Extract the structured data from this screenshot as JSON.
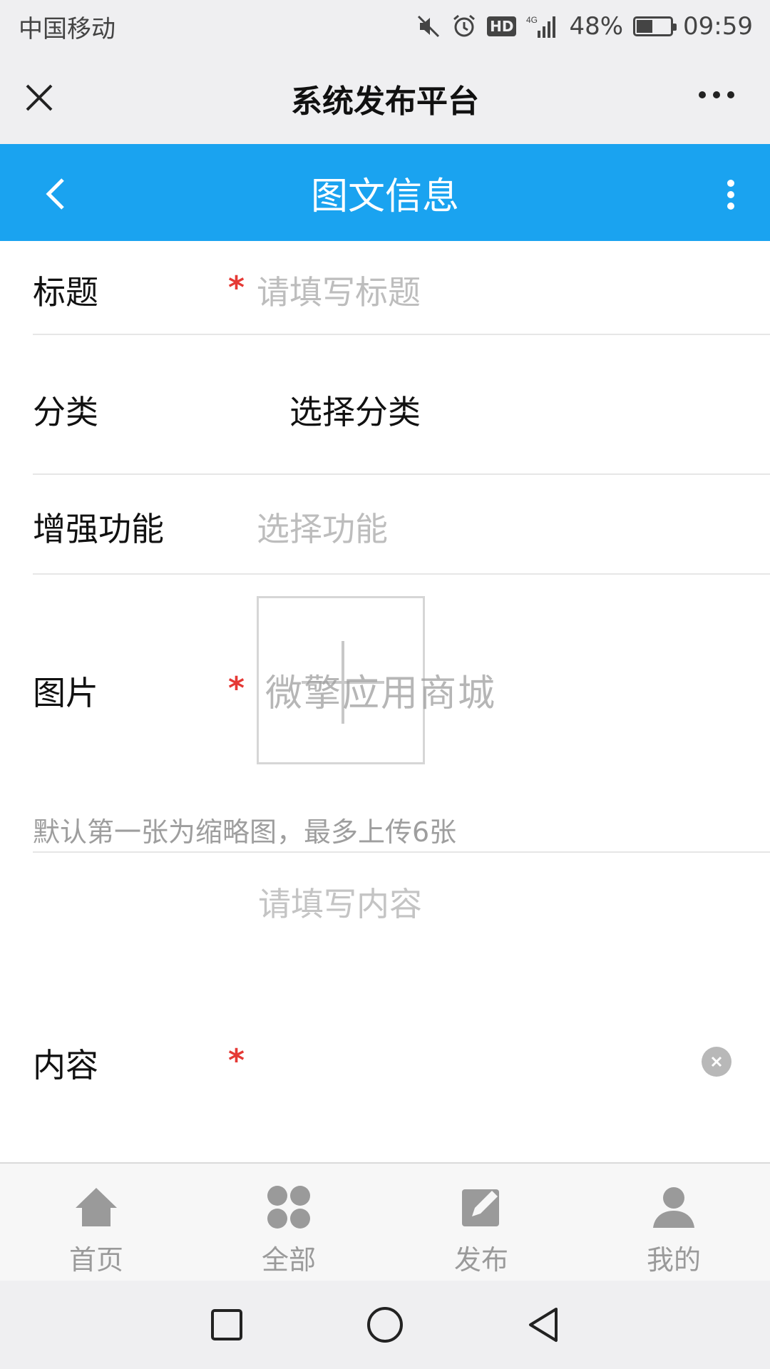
{
  "status_bar": {
    "carrier": "中国移动",
    "network": "4G",
    "battery": "48%",
    "battery_level": 0.48,
    "time": "09:59",
    "hd_label": "HD",
    "icons": [
      "mute-icon",
      "alarm-icon",
      "hd-icon",
      "signal-icon",
      "battery-icon"
    ]
  },
  "wechat_bar": {
    "title": "系统发布平台",
    "icons": [
      "close-icon",
      "more-icon"
    ]
  },
  "header": {
    "title": "图文信息",
    "color": "#1aa3f0",
    "icons": [
      "back-icon",
      "kebab-icon"
    ]
  },
  "form": {
    "title": {
      "label": "标题",
      "required": "*",
      "placeholder": "请填写标题"
    },
    "category": {
      "label": "分类",
      "value": "选择分类"
    },
    "features": {
      "label": "增强功能",
      "placeholder": "选择功能"
    },
    "image": {
      "label": "图片",
      "required": "*",
      "watermark": "微擎应用商城",
      "upload_icon": "plus-icon"
    },
    "hint": "默认第一张为缩略图，最多上传6张",
    "content": {
      "label": "内容",
      "required": "*",
      "placeholder": "请填写内容",
      "clear_icon": "clear-icon"
    },
    "required_color": "#e53935"
  },
  "tabbar": {
    "tabs": [
      {
        "label": "首页",
        "icon": "home-icon"
      },
      {
        "label": "全部",
        "icon": "grid-icon"
      },
      {
        "label": "发布",
        "icon": "edit-icon"
      },
      {
        "label": "我的",
        "icon": "user-icon"
      }
    ]
  },
  "system_nav": {
    "icons": [
      "recents-icon",
      "home-circle-icon",
      "back-triangle-icon"
    ]
  }
}
